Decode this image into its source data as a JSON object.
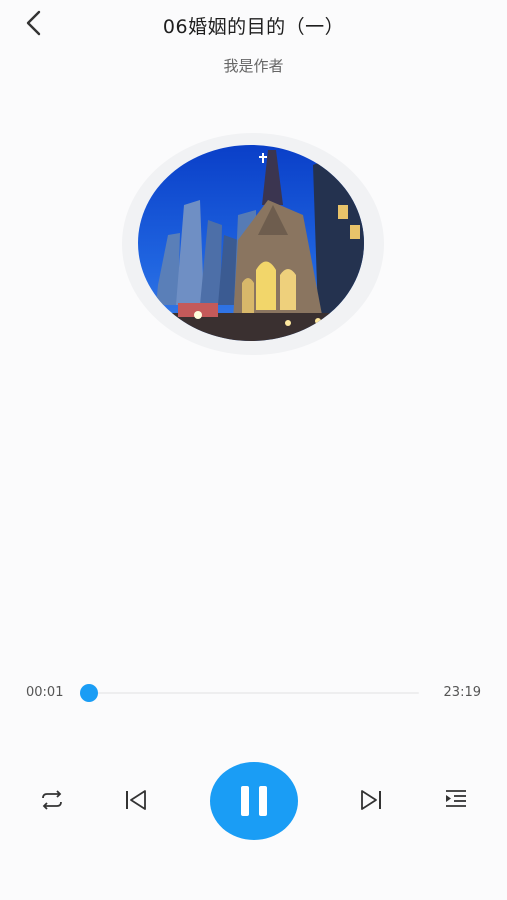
{
  "header": {
    "title": "06婚姻的目的（一）",
    "author": "我是作者",
    "back_icon": "chevron-left-icon"
  },
  "cover": {
    "description_icon": "album-cover"
  },
  "player": {
    "current_time": "00:01",
    "total_time": "23:19",
    "progress_fraction": 0.001,
    "state": "playing"
  },
  "controls": {
    "repeat_icon": "repeat-icon",
    "prev_icon": "skip-previous-icon",
    "play_icon": "pause-icon",
    "next_icon": "skip-next-icon",
    "playlist_icon": "playlist-icon"
  },
  "colors": {
    "accent": "#1a9df5",
    "background": "#fbfbfc",
    "icon": "#333333"
  }
}
